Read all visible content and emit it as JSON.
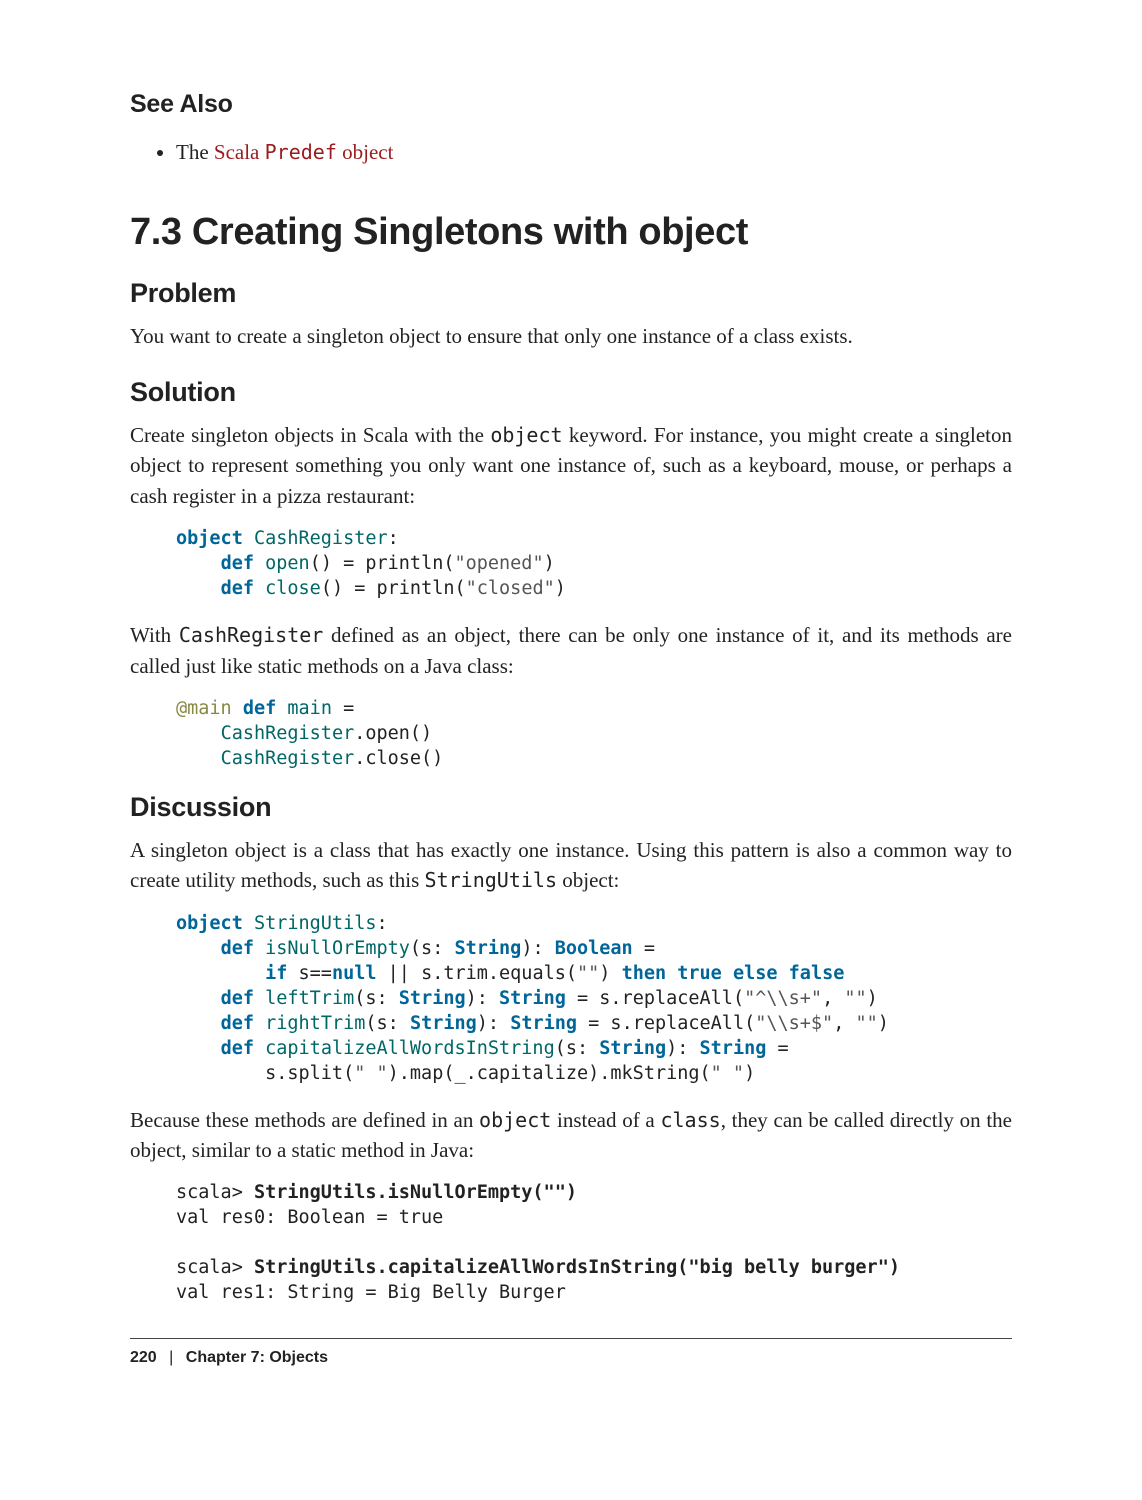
{
  "see_also": {
    "heading": "See Also",
    "item_prefix": "The ",
    "item_link_part1": "Scala ",
    "item_link_mono": "Predef",
    "item_link_part2": " object"
  },
  "section": {
    "title": "7.3 Creating Singletons with object"
  },
  "problem": {
    "heading": "Problem",
    "text": "You want to create a singleton object to ensure that only one instance of a class exists."
  },
  "solution": {
    "heading": "Solution",
    "p1a": "Create singleton objects in Scala with the ",
    "p1_mono": "object",
    "p1b": " keyword. For instance, you might create a singleton object to represent something you only want one instance of, such as a keyboard, mouse, or perhaps a cash register in a pizza restaurant:",
    "p2a": "With ",
    "p2_mono": "CashRegister",
    "p2b": " defined as an object, there can be only one instance of it, and its methods are called just like static methods on a Java class:"
  },
  "discussion": {
    "heading": "Discussion",
    "p1a": "A singleton object is a class that has exactly one instance. Using this pattern is also a common way to create utility methods, such as this ",
    "p1_mono": "StringUtils",
    "p1b": " object:",
    "p2a": "Because these methods are defined in an ",
    "p2_mono1": "object",
    "p2b": " instead of a ",
    "p2_mono2": "class",
    "p2c": ", they can be called directly on the object, similar to a static method in Java:"
  },
  "code": {
    "cash_def": {
      "kw_object": "object",
      "nm_class": "CashRegister",
      "colon1": ":",
      "kw_def1": "def",
      "nm_open": "open",
      "sig1": "() = println(",
      "str1": "\"opened\"",
      "end1": ")",
      "kw_def2": "def",
      "nm_close": "close",
      "sig2": "() = println(",
      "str2": "\"closed\"",
      "end2": ")"
    },
    "main": {
      "ann": "@main",
      "kw_def": "def",
      "nm_main": "main",
      "eq": " =",
      "l2a": "CashRegister",
      "l2b": ".open()",
      "l3a": "CashRegister",
      "l3b": ".close()"
    },
    "utils": {
      "kw_object": "object",
      "nm_class": "StringUtils",
      "colon": ":",
      "kw_def1": "def",
      "nm1": "isNullOrEmpty",
      "sig1a": "(s: ",
      "ty_str": "String",
      "sig1b": "): ",
      "ty_bool": "Boolean",
      "sig1c": " =",
      "kw_if": "if",
      "body1a": " s==",
      "kw_null": "null",
      "body1b": " || s.trim.equals(",
      "str_empty": "\"\"",
      "body1c": ") ",
      "kw_then": "then",
      "sp": " ",
      "kw_true": "true",
      "kw_else": "else",
      "kw_false": "false",
      "kw_def2": "def",
      "nm2": "leftTrim",
      "sig2a": "(s: ",
      "sig2b": "): ",
      "sig2c": " = s.replaceAll(",
      "str2a": "\"^\\\\s+\"",
      "comma": ", ",
      "sig2d": ")",
      "kw_def3": "def",
      "nm3": "rightTrim",
      "str3a": "\"\\\\s+$\"",
      "kw_def4": "def",
      "nm4": "capitalizeAllWordsInString",
      "body4": "s.split(",
      "str_sp": "\" \"",
      "body4b": ").map(_.capitalize).mkString(",
      "body4c": ")"
    },
    "repl": {
      "p1": "scala> ",
      "l1": "StringUtils.isNullOrEmpty(\"\")",
      "r1": "val res0: Boolean = true",
      "l2": "StringUtils.capitalizeAllWordsInString(\"big belly burger\")",
      "r2": "val res1: String = Big Belly Burger"
    }
  },
  "footer": {
    "page_num": "220",
    "separator": "|",
    "chapter": "Chapter 7: Objects"
  }
}
